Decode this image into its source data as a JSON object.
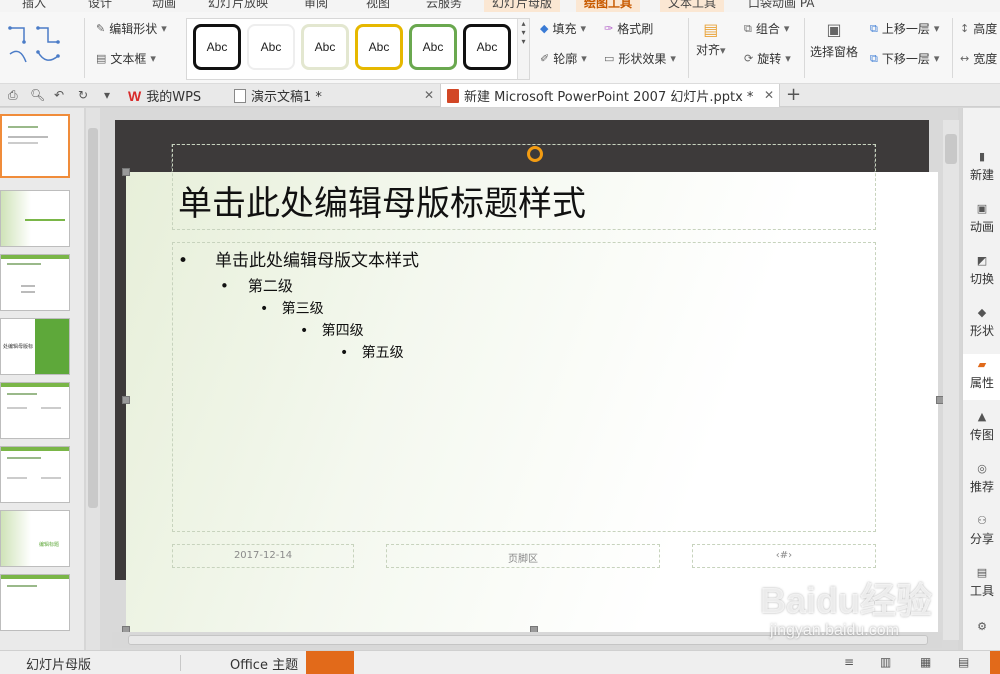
{
  "ribbon_tabs": [
    {
      "label": "插入"
    },
    {
      "label": "设计"
    },
    {
      "label": "动画"
    },
    {
      "label": "幻灯片放映"
    },
    {
      "label": "审阅"
    },
    {
      "label": "视图"
    },
    {
      "label": "云服务"
    },
    {
      "label": "幻灯片母版"
    },
    {
      "label": "绘图工具"
    },
    {
      "label": "文本工具"
    },
    {
      "label": "口袋动画 PA"
    }
  ],
  "ribbon": {
    "edit_shape": "编辑形状",
    "textbox": "文本框",
    "style_gallery": [
      "Abc",
      "Abc",
      "Abc",
      "Abc",
      "Abc",
      "Abc"
    ],
    "style_border_colors": [
      "#111111",
      "#f2f2f2",
      "#e3e7d0",
      "#e6b800",
      "#6aa84f",
      "#111111"
    ],
    "fill": "填充",
    "format_painter": "格式刷",
    "outline": "轮廓",
    "shape_effect": "形状效果",
    "align": "对齐",
    "group": "组合",
    "rotate": "旋转",
    "selection_pane": "选择窗格",
    "bring_forward": "上移一层",
    "send_backward": "下移一层",
    "height": "高度",
    "width": "宽度"
  },
  "doc_tabs": [
    {
      "label": "我的WPS",
      "icon": "wps-logo"
    },
    {
      "label": "演示文稿1 *",
      "icon": "document-icon"
    },
    {
      "label": "新建 Microsoft PowerPoint 2007 幻灯片.pptx *",
      "icon": "ppt-icon"
    }
  ],
  "slide": {
    "title": "单击此处编辑母版标题样式",
    "levels": [
      "单击此处编辑母版文本样式",
      "第二级",
      "第三级",
      "第四级",
      "第五级"
    ],
    "footer_date": "2017-12-14",
    "footer_center": "页脚区",
    "footer_number": "‹#›"
  },
  "thumbnails": [
    {
      "label": "编辑标题"
    },
    {
      "label": "处编辑母版标"
    },
    {
      "label": "编辑标题"
    }
  ],
  "sidebar": [
    {
      "label": "新建",
      "icon": "new-icon"
    },
    {
      "label": "动画",
      "icon": "animation-icon"
    },
    {
      "label": "切换",
      "icon": "transition-icon"
    },
    {
      "label": "形状",
      "icon": "shape-icon"
    },
    {
      "label": "属性",
      "icon": "property-icon"
    },
    {
      "label": "传图",
      "icon": "upload-image-icon"
    },
    {
      "label": "推荐",
      "icon": "recommend-icon"
    },
    {
      "label": "分享",
      "icon": "share-icon"
    },
    {
      "label": "工具",
      "icon": "toolbox-icon"
    }
  ],
  "status": {
    "view": "幻灯片母版",
    "theme": "Office 主题"
  },
  "watermark": {
    "main": "Baidu经验",
    "sub": "jingyan.baidu.com"
  },
  "colors": {
    "accent": "#e26a1a",
    "slide_green": "#7ab648"
  }
}
